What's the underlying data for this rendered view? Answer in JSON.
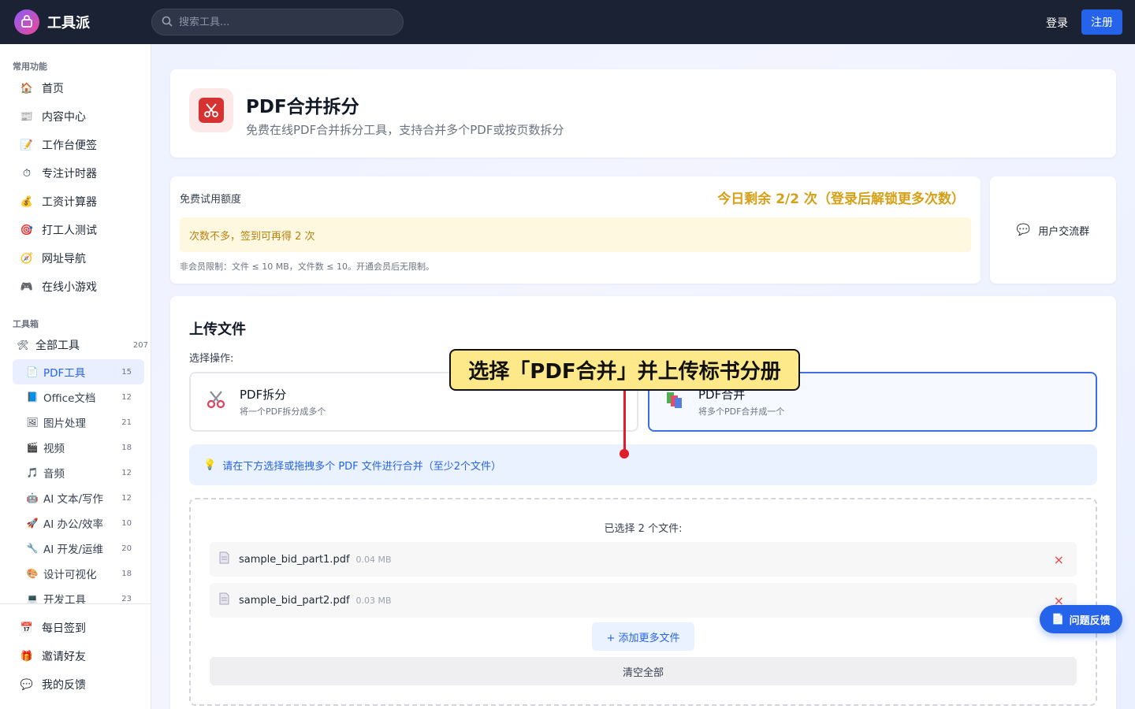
{
  "app": {
    "name": "工具派"
  },
  "search": {
    "placeholder": "搜索工具..."
  },
  "auth": {
    "login": "登录",
    "register": "注册"
  },
  "sidebar": {
    "common_title": "常用功能",
    "common": [
      {
        "icon": "house-icon",
        "glyph": "🏠",
        "label": "首页"
      },
      {
        "icon": "newspaper-icon",
        "glyph": "📰",
        "label": "内容中心"
      },
      {
        "icon": "memo-icon",
        "glyph": "📝",
        "label": "工作台便签"
      },
      {
        "icon": "stopwatch-icon",
        "glyph": "⏱",
        "label": "专注计时器"
      },
      {
        "icon": "money-bag-icon",
        "glyph": "💰",
        "label": "工资计算器"
      },
      {
        "icon": "target-icon",
        "glyph": "🎯",
        "label": "打工人测试"
      },
      {
        "icon": "compass-icon",
        "glyph": "🧭",
        "label": "网址导航"
      },
      {
        "icon": "gamepad-icon",
        "glyph": "🎮",
        "label": "在线小游戏"
      }
    ],
    "toolbox_title": "工具箱",
    "all_tools": {
      "icon": "tools-icon",
      "glyph": "🛠",
      "label": "全部工具",
      "count": "207"
    },
    "categories": [
      {
        "icon": "pdf-doc-icon",
        "glyph": "📄",
        "label": "PDF工具",
        "count": "15",
        "active": true
      },
      {
        "icon": "office-doc-icon",
        "glyph": "📘",
        "label": "Office文档",
        "count": "12"
      },
      {
        "icon": "picture-icon",
        "glyph": "🖼",
        "label": "图片处理",
        "count": "21"
      },
      {
        "icon": "clapper-icon",
        "glyph": "🎬",
        "label": "视频",
        "count": "18"
      },
      {
        "icon": "music-note-icon",
        "glyph": "🎵",
        "label": "音频",
        "count": "12"
      },
      {
        "icon": "robot-icon",
        "glyph": "🤖",
        "label": "AI 文本/写作",
        "count": "12"
      },
      {
        "icon": "rocket-icon",
        "glyph": "🚀",
        "label": "AI 办公/效率",
        "count": "10"
      },
      {
        "icon": "wrench-icon",
        "glyph": "🔧",
        "label": "AI 开发/运维",
        "count": "20"
      },
      {
        "icon": "palette-icon",
        "glyph": "🎨",
        "label": "设计可视化",
        "count": "18"
      },
      {
        "icon": "laptop-icon",
        "glyph": "💻",
        "label": "开发工具",
        "count": "23"
      }
    ],
    "bottom": [
      {
        "icon": "calendar-icon",
        "glyph": "📅",
        "label": "每日签到"
      },
      {
        "icon": "gift-icon",
        "glyph": "🎁",
        "label": "邀请好友"
      },
      {
        "icon": "speech-bubble-icon",
        "glyph": "💬",
        "label": "我的反馈"
      }
    ]
  },
  "tool": {
    "title": "PDF合并拆分",
    "subtitle": "免费在线PDF合并拆分工具，支持合并多个PDF或按页数拆分",
    "icon": "scissors-icon"
  },
  "quota": {
    "label": "免费试用额度",
    "remaining": "今日剩余 2/2 次（登录后解锁更多次数）",
    "warning": "次数不多，签到可再得 2 次",
    "note": "非会员限制：文件 ≤ 10 MB，文件数 ≤ 10。开通会员后无限制。"
  },
  "community": {
    "label": "用户交流群"
  },
  "upload": {
    "title": "上传文件",
    "op_label": "选择操作:",
    "ops": [
      {
        "name": "PDF拆分",
        "desc": "将一个PDF拆分成多个",
        "selected": false
      },
      {
        "name": "PDF合并",
        "desc": "将多个PDF合并成一个",
        "selected": true
      }
    ],
    "hint": "请在下方选择或拖拽多个 PDF 文件进行合并（至少2个文件）",
    "selected_count": "已选择 2 个文件:",
    "files": [
      {
        "name": "sample_bid_part1.pdf",
        "size": "0.04 MB"
      },
      {
        "name": "sample_bid_part2.pdf",
        "size": "0.03 MB"
      }
    ],
    "remove_glyph": "×",
    "add_more": "+ 添加更多文件",
    "clear_all": "清空全部"
  },
  "callout": {
    "text": "选择「PDF合并」并上传标书分册"
  },
  "feedback": {
    "label": "问题反馈"
  }
}
